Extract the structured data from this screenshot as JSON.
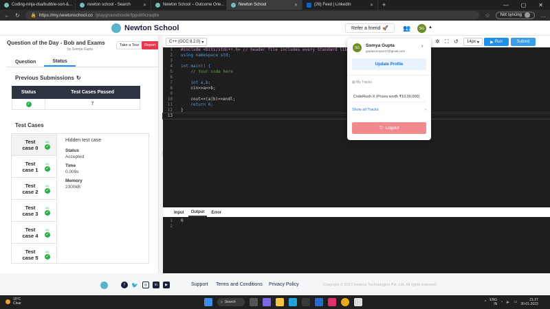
{
  "browser": {
    "tabs": [
      {
        "label": "Coding-ninja-dsa/bubble-sort-&...",
        "active": false
      },
      {
        "label": "newton school - Search",
        "active": false
      },
      {
        "label": "Newton School – Outcome Orie...",
        "active": false
      },
      {
        "label": "Newton School",
        "active": true
      },
      {
        "label": "(26) Feed | LinkedIn",
        "active": false
      }
    ],
    "url_domain": "https://my.newtonschool.co",
    "url_path": "/playground/code/fppo80czaq9o",
    "sync_label": "Not syncing"
  },
  "header": {
    "brand": "Newton School",
    "refer_label": "Refer a friend",
    "avatar_initials": "SG"
  },
  "question": {
    "title": "Question of the Day - Bob and Exams",
    "by": "by Somya Gupta",
    "tour_label": "Take a Tour",
    "report_label": "Report"
  },
  "left_tabs": {
    "question": "Question",
    "status": "Status"
  },
  "status": {
    "heading": "Previous Submissions",
    "col_status": "Status",
    "col_passed": "Test Cases Passed",
    "passed": "7"
  },
  "test_cases": {
    "heading": "Test Cases",
    "items": [
      {
        "name": "Test case 0",
        "badge": "AC"
      },
      {
        "name": "Test case 1",
        "badge": "AC"
      },
      {
        "name": "Test case 2",
        "badge": "AC"
      },
      {
        "name": "Test case 3",
        "badge": "AC"
      },
      {
        "name": "Test case 4",
        "badge": "AC"
      },
      {
        "name": "Test case 5",
        "badge": "AC"
      }
    ],
    "detail": {
      "hidden": "Hidden test case",
      "status_label": "Status",
      "status_value": "Accepted",
      "time_label": "Time",
      "time_value": "0.009s",
      "memory_label": "Memory",
      "memory_value": "2300kB"
    }
  },
  "editor": {
    "language": "C++ (GCC 9.2.0)",
    "font_size": "14px",
    "run_label": "Run",
    "submit_label": "Submit",
    "lines": [
      "#include <bits/stdc++.h> // header file includes every Standard library",
      "using namespace std;",
      "",
      "int main() {",
      "    // Your code here",
      "",
      "    int a,b;",
      "    cin>>a>>b;",
      "",
      "    cout<<(a|b)<<endl;",
      "    return 0;",
      "}",
      ""
    ],
    "io_tabs": {
      "input": "Input",
      "output": "Output",
      "error": "Error"
    },
    "output_lines": [
      "0",
      ""
    ]
  },
  "profile": {
    "name": "Somya Gupta",
    "email": "guptasomya417@gmail.com",
    "update_label": "Update Profile",
    "tracks_label": "My Tracks",
    "track": "CodeRush-X (Prizes worth ₹10,00,000)",
    "show_all": "Show all Tracks",
    "logout": "Logout"
  },
  "footer": {
    "support": "Support",
    "terms": "Terms and Conditions",
    "privacy": "Privacy Policy",
    "copyright": "Copyright © 2023 Incanus Technologies Pvt. Ltd. All rights reserved."
  },
  "taskbar": {
    "temp": "15°C",
    "weather": "Clear",
    "search": "Search",
    "lang": "ENG",
    "region": "IN",
    "time": "21:27",
    "date": "30-01-2023"
  }
}
